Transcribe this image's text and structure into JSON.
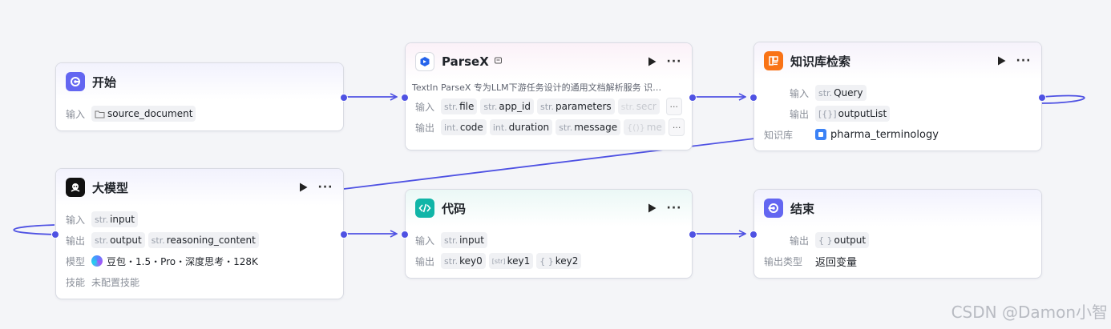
{
  "nodes": {
    "start": {
      "title": "开始",
      "input_label": "输入",
      "input_value": "source_document"
    },
    "parsex": {
      "title": "ParseX",
      "description": "TextIn ParseX 专为LLM下游任务设计的通用文档解析服务 识…",
      "input_label": "输入",
      "inputs": [
        {
          "type": "str.",
          "name": "file"
        },
        {
          "type": "str.",
          "name": "app_id"
        },
        {
          "type": "str.",
          "name": "parameters"
        },
        {
          "type": "str.",
          "name": "secr"
        }
      ],
      "output_label": "输出",
      "outputs": [
        {
          "type": "int.",
          "name": "code"
        },
        {
          "type": "int.",
          "name": "duration"
        },
        {
          "type": "str.",
          "name": "message"
        },
        {
          "type": "{()}",
          "name": "me"
        }
      ],
      "more": "···"
    },
    "kb": {
      "title": "知识库检索",
      "input_label": "输入",
      "input_type": "str.",
      "input_name": "Query",
      "output_label": "输出",
      "output_type": "[{}]",
      "output_name": "outputList",
      "kb_label": "知识库",
      "kb_value": "pharma_terminology"
    },
    "llm": {
      "title": "大模型",
      "input_label": "输入",
      "input_type": "str.",
      "input_name": "input",
      "output_label": "输出",
      "outputs": [
        {
          "type": "str.",
          "name": "output"
        },
        {
          "type": "str.",
          "name": "reasoning_content"
        }
      ],
      "model_label": "模型",
      "model_value": "豆包・1.5・Pro・深度思考・128K",
      "skill_label": "技能",
      "skill_value": "未配置技能"
    },
    "code": {
      "title": "代码",
      "input_label": "输入",
      "input_type": "str.",
      "input_name": "input",
      "output_label": "输出",
      "outputs": [
        {
          "type": "str.",
          "name": "key0"
        },
        {
          "type": "[str]",
          "name": "key1"
        },
        {
          "type": "{ }",
          "name": "key2"
        }
      ]
    },
    "end": {
      "title": "结束",
      "output_label": "输出",
      "output_type": "{ }",
      "output_name": "output",
      "output_kind_label": "输出类型",
      "output_kind_value": "返回变量"
    }
  },
  "more_icon": "···",
  "watermark": "CSDN @Damon小智",
  "colors": {
    "edge": "#4f52e3",
    "start_icon": "#6366f1",
    "code_icon": "#10b5a7",
    "kb_icon": "#f97316"
  }
}
